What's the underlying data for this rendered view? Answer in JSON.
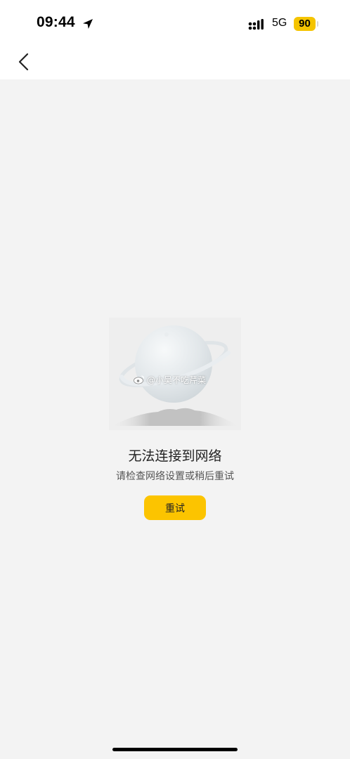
{
  "status_bar": {
    "time": "09:44",
    "network": "5G",
    "battery_level": "90",
    "battery_color": "#f5c400",
    "icons": [
      "location-arrow-icon",
      "signal-icon",
      "battery-icon"
    ]
  },
  "nav": {
    "back_icon": "chevron-left-icon"
  },
  "illustration": {
    "icon": "planet-icon",
    "watermark": "@小吴不吃芹菜"
  },
  "error": {
    "title": "无法连接到网络",
    "subtitle": "请检查网络设置或稍后重试"
  },
  "actions": {
    "retry_label": "重试",
    "accent_color": "#fcc400"
  }
}
